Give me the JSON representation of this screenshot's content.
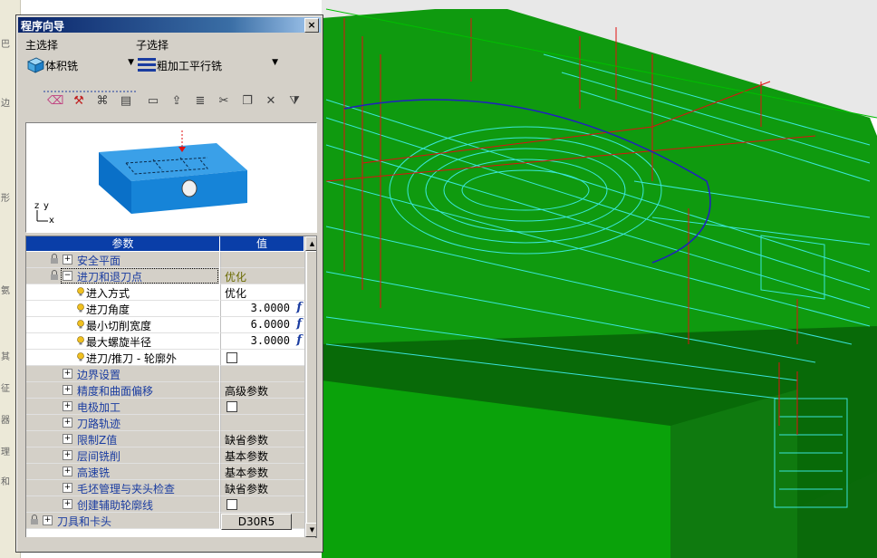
{
  "window": {
    "title": "程序向导",
    "close": "×"
  },
  "main_select": {
    "label": "主选择",
    "value": "体积铣"
  },
  "sub_select": {
    "label": "子选择",
    "value": "粗加工平行铣"
  },
  "grid": {
    "header_param": "参数",
    "header_value": "值",
    "rows": [
      {
        "label": "安全平面",
        "value": ""
      },
      {
        "label": "进刀和退刀点",
        "value": "优化"
      },
      {
        "label": "进入方式",
        "value": "优化"
      },
      {
        "label": "进刀角度",
        "value": "3.0000"
      },
      {
        "label": "最小切削宽度",
        "value": "6.0000"
      },
      {
        "label": "最大螺旋半径",
        "value": "3.0000"
      },
      {
        "label": "进刀/推刀 - 轮廓外",
        "value": ""
      },
      {
        "label": "边界设置",
        "value": ""
      },
      {
        "label": "精度和曲面偏移",
        "value": "高级参数"
      },
      {
        "label": "电极加工",
        "value": ""
      },
      {
        "label": "刀路轨迹",
        "value": ""
      },
      {
        "label": "限制Z值",
        "value": "缺省参数"
      },
      {
        "label": "层间铣削",
        "value": "基本参数"
      },
      {
        "label": "高速铣",
        "value": "基本参数"
      },
      {
        "label": "毛坯管理与夹头检查",
        "value": "缺省参数"
      },
      {
        "label": "创建辅助轮廓线",
        "value": ""
      },
      {
        "label": "刀具和卡头",
        "value": "D30R5"
      }
    ],
    "fx": "f"
  },
  "preview": {
    "axis_z": "z",
    "axis_y": "y",
    "axis_x": "x"
  },
  "toolbar_icons": [
    "eraser-icon",
    "hammer-icon",
    "tool-path-icon",
    "list-icon",
    "monitor-icon",
    "export-icon",
    "stack-icon",
    "cut-icon",
    "window-icon",
    "delete-icon",
    "filter-icon"
  ],
  "colors": {
    "title_blue": "#0a246a",
    "header_blue": "#0a3ea8",
    "model_green": "#10a010",
    "toolpath_cyan": "#40f0f0",
    "toolpath_red": "#e01010"
  }
}
